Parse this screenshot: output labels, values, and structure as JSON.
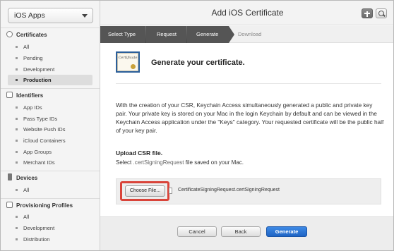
{
  "sidebar": {
    "app_selector": "iOS Apps",
    "sections": [
      {
        "title": "Certificates",
        "items": [
          "All",
          "Pending",
          "Development",
          "Production"
        ],
        "active_index": 3
      },
      {
        "title": "Identifiers",
        "items": [
          "App IDs",
          "Pass Type IDs",
          "Website Push IDs",
          "iCloud Containers",
          "App Groups",
          "Merchant IDs"
        ]
      },
      {
        "title": "Devices",
        "items": [
          "All"
        ]
      },
      {
        "title": "Provisioning Profiles",
        "items": [
          "All",
          "Development",
          "Distribution"
        ]
      }
    ]
  },
  "header": {
    "title": "Add iOS Certificate"
  },
  "steps": [
    "Select Type",
    "Request",
    "Generate",
    "Download"
  ],
  "content": {
    "heading": "Generate your certificate.",
    "icon_text": "Certificate",
    "description": "With the creation of your CSR, Keychain Access simultaneously generated a public and private key pair. Your private key is stored on your Mac in the login Keychain by default and can be viewed in the Keychain Access application under the \"Keys\" category. Your requested certificate will be the public half of your key pair.",
    "upload_title": "Upload CSR file.",
    "upload_sub_prefix": "Select ",
    "upload_sub_file": ".certSigningRequest",
    "upload_sub_suffix": " file saved on your Mac.",
    "choose_button": "Choose File...",
    "file_name": "CertificateSigningRequest.certSigningRequest"
  },
  "footer": {
    "cancel": "Cancel",
    "back": "Back",
    "generate": "Generate"
  },
  "colors": {
    "step_active": "#555555",
    "highlight": "#d9443a",
    "primary": "#2a74d6"
  }
}
